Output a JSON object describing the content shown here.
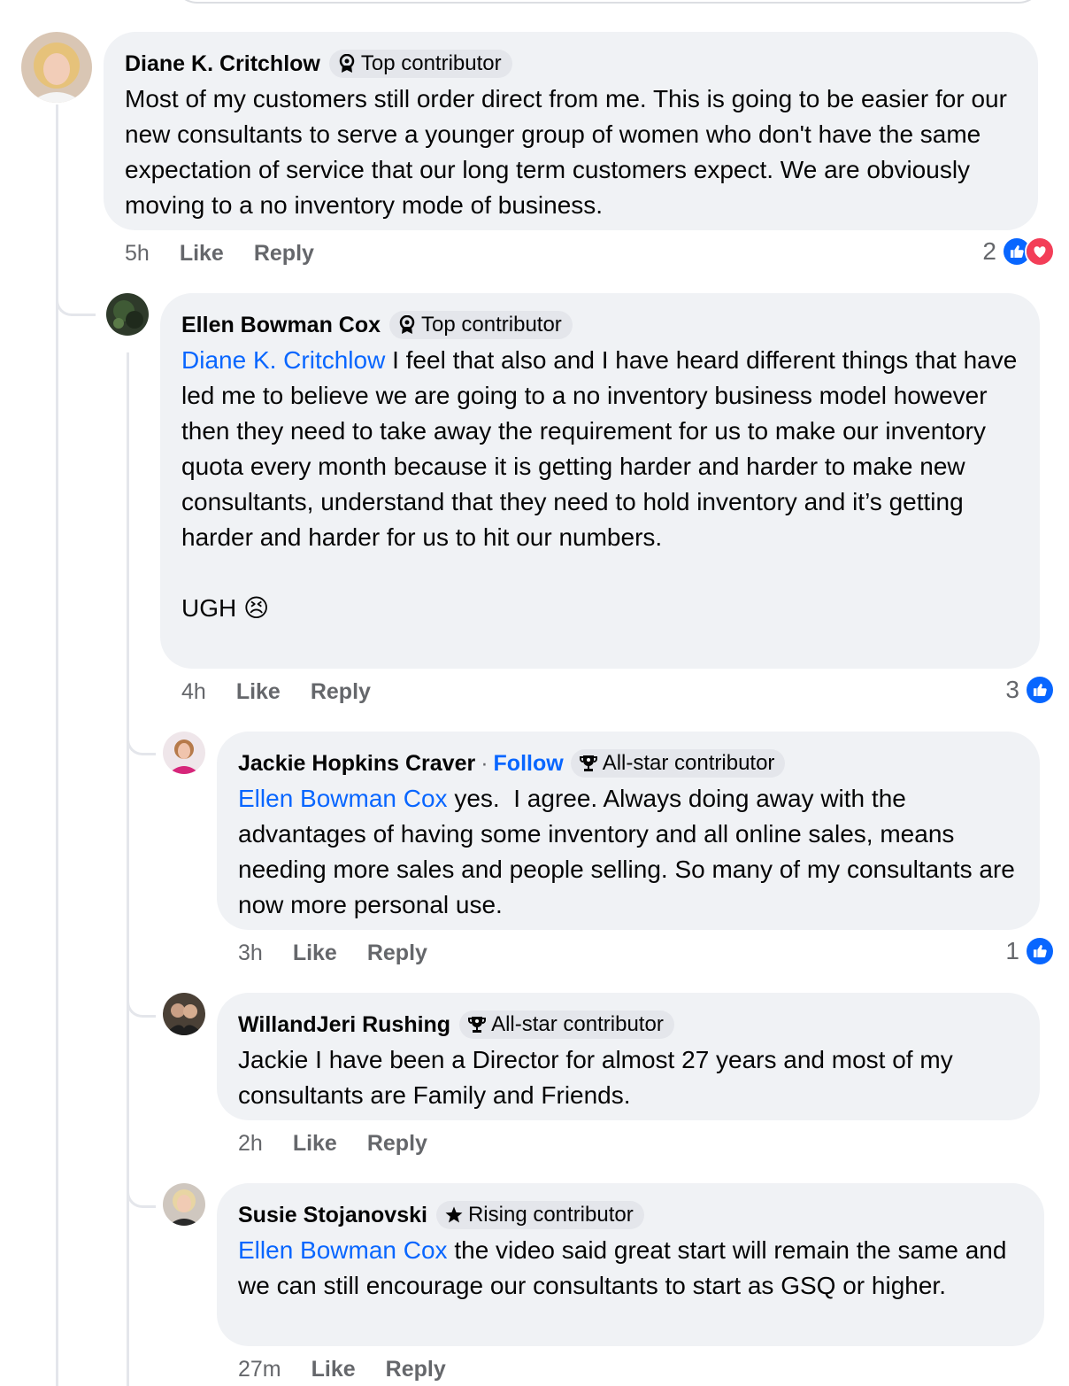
{
  "comments": [
    {
      "author": "Diane K. Critchlow",
      "badge": "Top contributor",
      "badge_icon": "award-icon",
      "mention": "",
      "text": "Most of my customers still order direct from me. This is going to be easier for our new consultants to serve a younger group of women who don't have the same expectation of service that our long term customers expect. We are obviously moving to a no inventory mode of business.",
      "time": "5h",
      "like": "Like",
      "reply": "Reply",
      "reaction_count": "2",
      "reactions": [
        "like-reaction-icon",
        "love-reaction-icon"
      ]
    },
    {
      "author": "Ellen Bowman Cox",
      "badge": "Top contributor",
      "badge_icon": "award-icon",
      "mention": "Diane K. Critchlow",
      "text": " I feel that also and I have heard different things that have led me to believe we are going to a no inventory business model however then they need to take away the requirement for us to make our inventory quota every month because it is getting harder and harder to make new consultants, understand that they need to hold inventory and it’s getting harder and harder for us to hit our numbers.\n\nUGH",
      "emoji": "😣",
      "time": "4h",
      "like": "Like",
      "reply": "Reply",
      "reaction_count": "3",
      "reactions": [
        "like-reaction-icon"
      ]
    },
    {
      "author": "Jackie Hopkins Craver",
      "separator": "·",
      "follow": "Follow",
      "badge": "All-star contributor",
      "badge_icon": "trophy-icon",
      "mention": "Ellen Bowman Cox",
      "text": " yes.  I agree. Always doing away with the advantages of having some inventory and all online sales, means needing more sales and people selling. So many of my consultants are now more personal use.",
      "time": "3h",
      "like": "Like",
      "reply": "Reply",
      "reaction_count": "1",
      "reactions": [
        "like-reaction-icon"
      ]
    },
    {
      "author": "WillandJeri Rushing",
      "badge": "All-star contributor",
      "badge_icon": "trophy-icon",
      "mention": "",
      "text": "Jackie I have been a Director for almost 27 years and most of my consultants are Family and Friends.",
      "time": "2h",
      "like": "Like",
      "reply": "Reply"
    },
    {
      "author": "Susie Stojanovski",
      "badge": "Rising contributor",
      "badge_icon": "star-icon",
      "mention": "Ellen Bowman Cox",
      "text": " the video said great start will remain the same and we can still encourage our consultants to start as GSQ or higher.",
      "time": "27m",
      "like": "Like",
      "reply": "Reply"
    }
  ],
  "colors": {
    "bubble": "#f0f2f5",
    "badge": "#e4e6eb",
    "link": "#0866ff",
    "meta": "#65676b",
    "like": "#0866ff",
    "love": "#f33e58"
  }
}
